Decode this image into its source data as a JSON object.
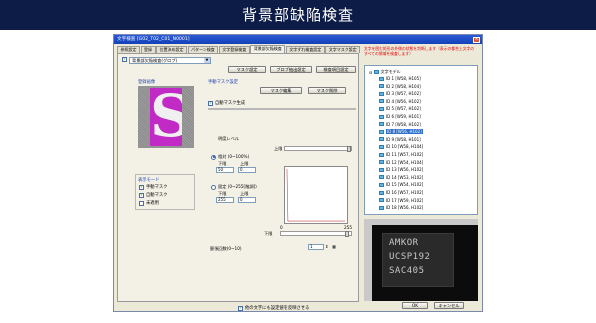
{
  "banner": {
    "title": "背景部缺陥検査"
  },
  "window": {
    "title": "文字検査 [G02_T02_C01_N0001]",
    "close": "×",
    "tabs": [
      "参照設定",
      "登録",
      "位置決め設定",
      "パターン検査",
      "文字登録検査",
      "背景部欠陥検査",
      "文字ずれ検査設定",
      "文字マスク設定"
    ],
    "active_tab": "背景部欠陥検査",
    "top_checkbox": "背景部欠陥検査(グロブ)",
    "buttons": {
      "mask_set": "マスク設定",
      "blob_set": "ブロブ抽出設定",
      "inspect_set": "検査項目設定"
    },
    "mask_group": "登録画像",
    "mask_glyph": "S",
    "manual_mask_group": "手動マスク設定",
    "mask_edit": "マスク編集",
    "mask_delete": "マスク削除",
    "auto_mask": "自動マスク生成",
    "display_mode": {
      "title": "表示モード",
      "items": [
        {
          "label": "手動マスク",
          "checked": true
        },
        {
          "label": "自動マスク",
          "checked": true
        },
        {
          "label": "未適用",
          "checked": false
        }
      ]
    },
    "brightness_label": "明度レベル",
    "upper": "上限",
    "lower": "下限",
    "radio_relative": "相対 (0~100%)",
    "radio_fixed": "固定 (0~255[階調])",
    "relative": {
      "lower_label": "下限",
      "upper_label": "上限",
      "lower_value": "50",
      "upper_value": "0"
    },
    "fixed": {
      "lower_label": "下限",
      "upper_label": "上限",
      "lower_value": "255",
      "upper_value": "0"
    },
    "graph_axis": {
      "min": "0",
      "max": "255"
    },
    "shrink_label": "膨張回数(0~10)",
    "shrink_value": "1",
    "apply_check": "他の文字にも設定値を反映させる",
    "ok": "OK",
    "cancel": "キャンセル"
  },
  "tree": {
    "root": "文字モデル",
    "warning": "文字を囲む矩形の外側の状態を判断します（表示の都合上文字のすべての領域を検査します）",
    "items": [
      "ID 1 [W58, H105]",
      "ID 2 [W58, H104]",
      "ID 3 [W57, H102]",
      "ID 4 [W56, H102]",
      "ID 5 [W57, H102]",
      "ID 6 [W59, H101]",
      "ID 7 [W58, H102]",
      "ID 8 [W56, H102]",
      "ID 9 [W58, H101]",
      "ID 10 [W58, H104]",
      "ID 11 [W57, H102]",
      "ID 12 [W54, H104]",
      "ID 13 [W56, H102]",
      "ID 14 [W53, H102]",
      "ID 15 [W54, H102]",
      "ID 16 [W57, H102]",
      "ID 17 [W59, H102]",
      "ID 18 [W56, H102]"
    ],
    "selected_index": 7
  },
  "camera": {
    "lines": [
      "AMKOR",
      "UCSP192",
      "SAC405"
    ]
  },
  "colors": {
    "banner": "#0c1c46",
    "selection": "#2f6fcc",
    "glyph_bg": "#c12ac4"
  }
}
